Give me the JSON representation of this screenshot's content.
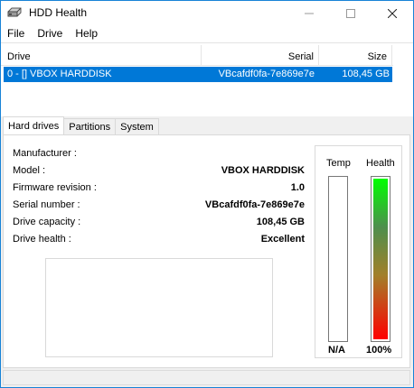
{
  "window": {
    "title": "HDD Health",
    "accent": "#0078d7"
  },
  "menu": {
    "items": [
      "File",
      "Drive",
      "Help"
    ]
  },
  "drive_list": {
    "columns": {
      "drive": "Drive",
      "serial": "Serial",
      "size": "Size"
    },
    "rows": [
      {
        "drive": "0 - [] VBOX HARDDISK",
        "serial": "VBcafdf0fa-7e869e7e",
        "size": "108,45 GB",
        "selected": true
      }
    ]
  },
  "tabs": [
    "Hard drives",
    "Partitions",
    "System"
  ],
  "active_tab": "Hard drives",
  "details": {
    "manufacturer": {
      "label": "Manufacturer :",
      "value": ""
    },
    "model": {
      "label": "Model :",
      "value": "VBOX HARDDISK"
    },
    "firmware": {
      "label": "Firmware revision :",
      "value": "1.0"
    },
    "serial": {
      "label": "Serial number :",
      "value": "VBcafdf0fa-7e869e7e"
    },
    "capacity": {
      "label": "Drive capacity :",
      "value": "108,45 GB"
    },
    "health": {
      "label": "Drive health :",
      "value": "Excellent"
    }
  },
  "gauges": {
    "temp": {
      "label": "Temp",
      "value": "N/A"
    },
    "health": {
      "label": "Health",
      "value": "100%",
      "percent": 100
    }
  }
}
